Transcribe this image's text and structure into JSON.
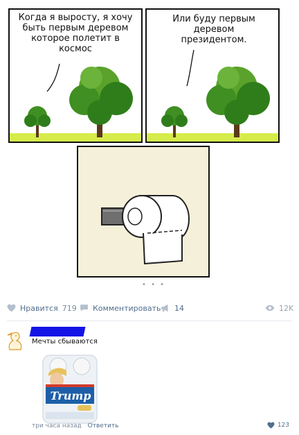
{
  "comic": {
    "panel1_text": "Когда я выросту, я хочу\nбыть первым деревом\nкоторое полетит в\nкосмос",
    "panel2_text": "Или буду первым\nдеревом\nпрезидентом."
  },
  "post_actions": {
    "like_label": "Нравится",
    "like_count": "719",
    "comment_label": "Комментировать",
    "share_count": "14",
    "views": "12K"
  },
  "comment": {
    "text": "Мечты сбываются",
    "time": "три часа назад",
    "reply_label": "Ответить",
    "likes": "123",
    "product_brand": "Trump"
  },
  "colors": {
    "link": "#4f6e8e",
    "muted": "#7b8a9b",
    "grass": "#d6ec4a",
    "tree_dark": "#2f7d1a",
    "tree_light": "#5aa22b"
  },
  "icons": [
    "heart-icon",
    "comment-icon",
    "megaphone-icon",
    "eye-icon"
  ]
}
